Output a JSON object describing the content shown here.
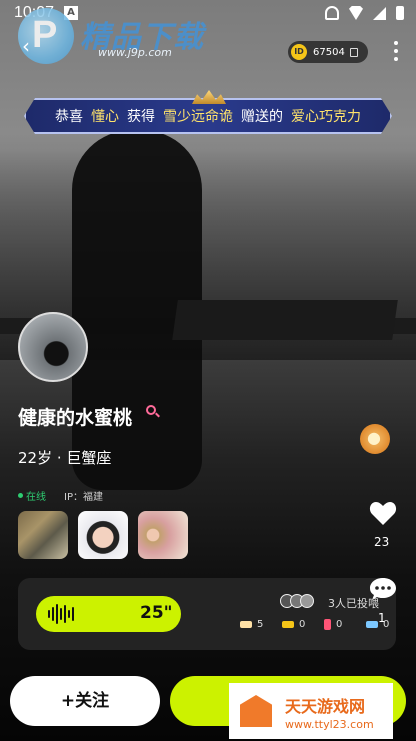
{
  "status_bar": {
    "time": "10:07"
  },
  "watermark_top": {
    "title": "精品下载",
    "url": "www.j9p.com",
    "logo_letter": "P"
  },
  "header": {
    "id_badge": "ID",
    "id_value": "67504"
  },
  "banner": {
    "parts": [
      "恭喜",
      "懂心",
      "获得",
      "雪少远命诡",
      "赠送的",
      "爱心巧克力"
    ]
  },
  "profile": {
    "name": "健康的水蜜桃",
    "age_sign": "22岁 · 巨蟹座",
    "online": "在线",
    "ip": "IP：福建"
  },
  "actions": {
    "like_count": "23",
    "comment_count": "1"
  },
  "voice": {
    "duration": "25\"",
    "voters_text": "3人已投喂",
    "stats": [
      {
        "icon": "bone-icon",
        "value": "5",
        "color": "#ffe1a6"
      },
      {
        "icon": "hamburger-icon",
        "value": "0",
        "color": "#f5c518"
      },
      {
        "icon": "drink-icon",
        "value": "0",
        "color": "#ff5577"
      },
      {
        "icon": "bone-blue-icon",
        "value": "0",
        "color": "#7cc8ff"
      }
    ]
  },
  "buttons": {
    "follow": "+关注"
  },
  "watermark_bottom": {
    "title": "天天游戏网",
    "url": "www.ttyl23.com"
  },
  "colors": {
    "accent": "#ccf200",
    "online": "#2ecc71"
  }
}
